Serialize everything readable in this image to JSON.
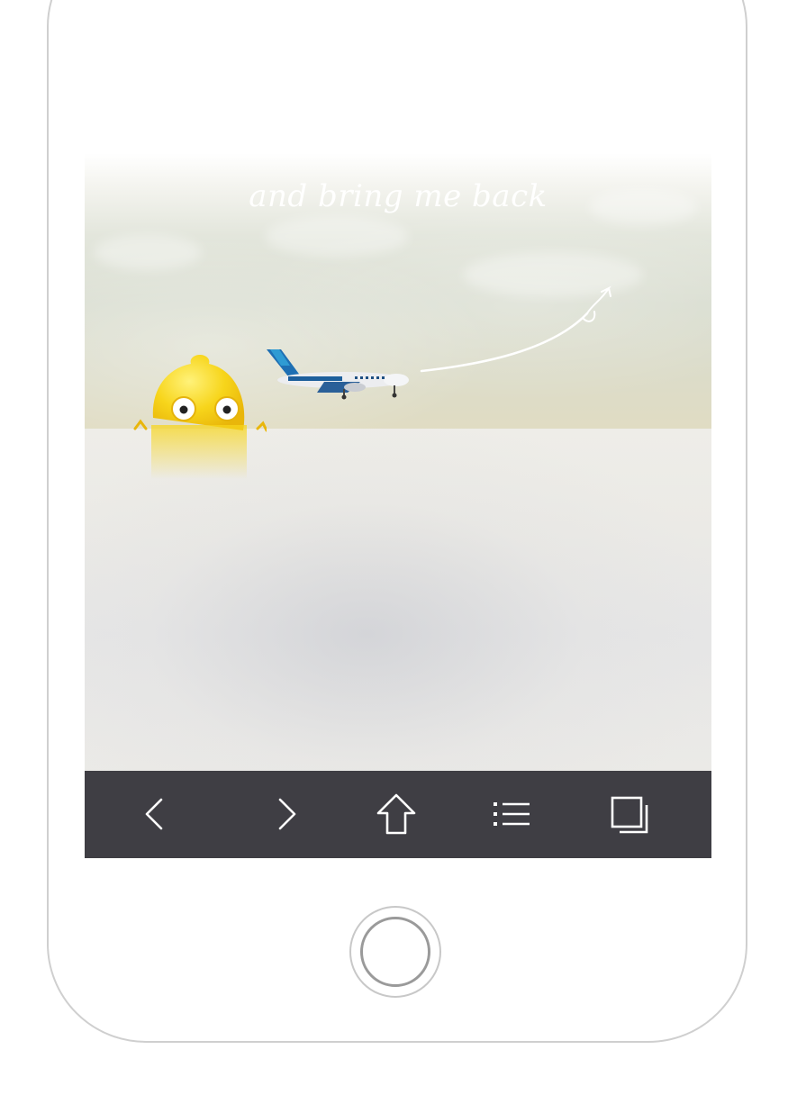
{
  "screen": {
    "tagline": "and bring me back"
  },
  "toolbar": {
    "back": "back-arrow-icon",
    "forward": "forward-arrow-icon",
    "home": "home-icon",
    "menu": "list-menu-icon",
    "tabs": "tabs-icon"
  },
  "colors": {
    "toolbar_bg": "#3f3e44",
    "icon_color": "#ffffff",
    "mascot_yellow": "#f6d21c"
  }
}
